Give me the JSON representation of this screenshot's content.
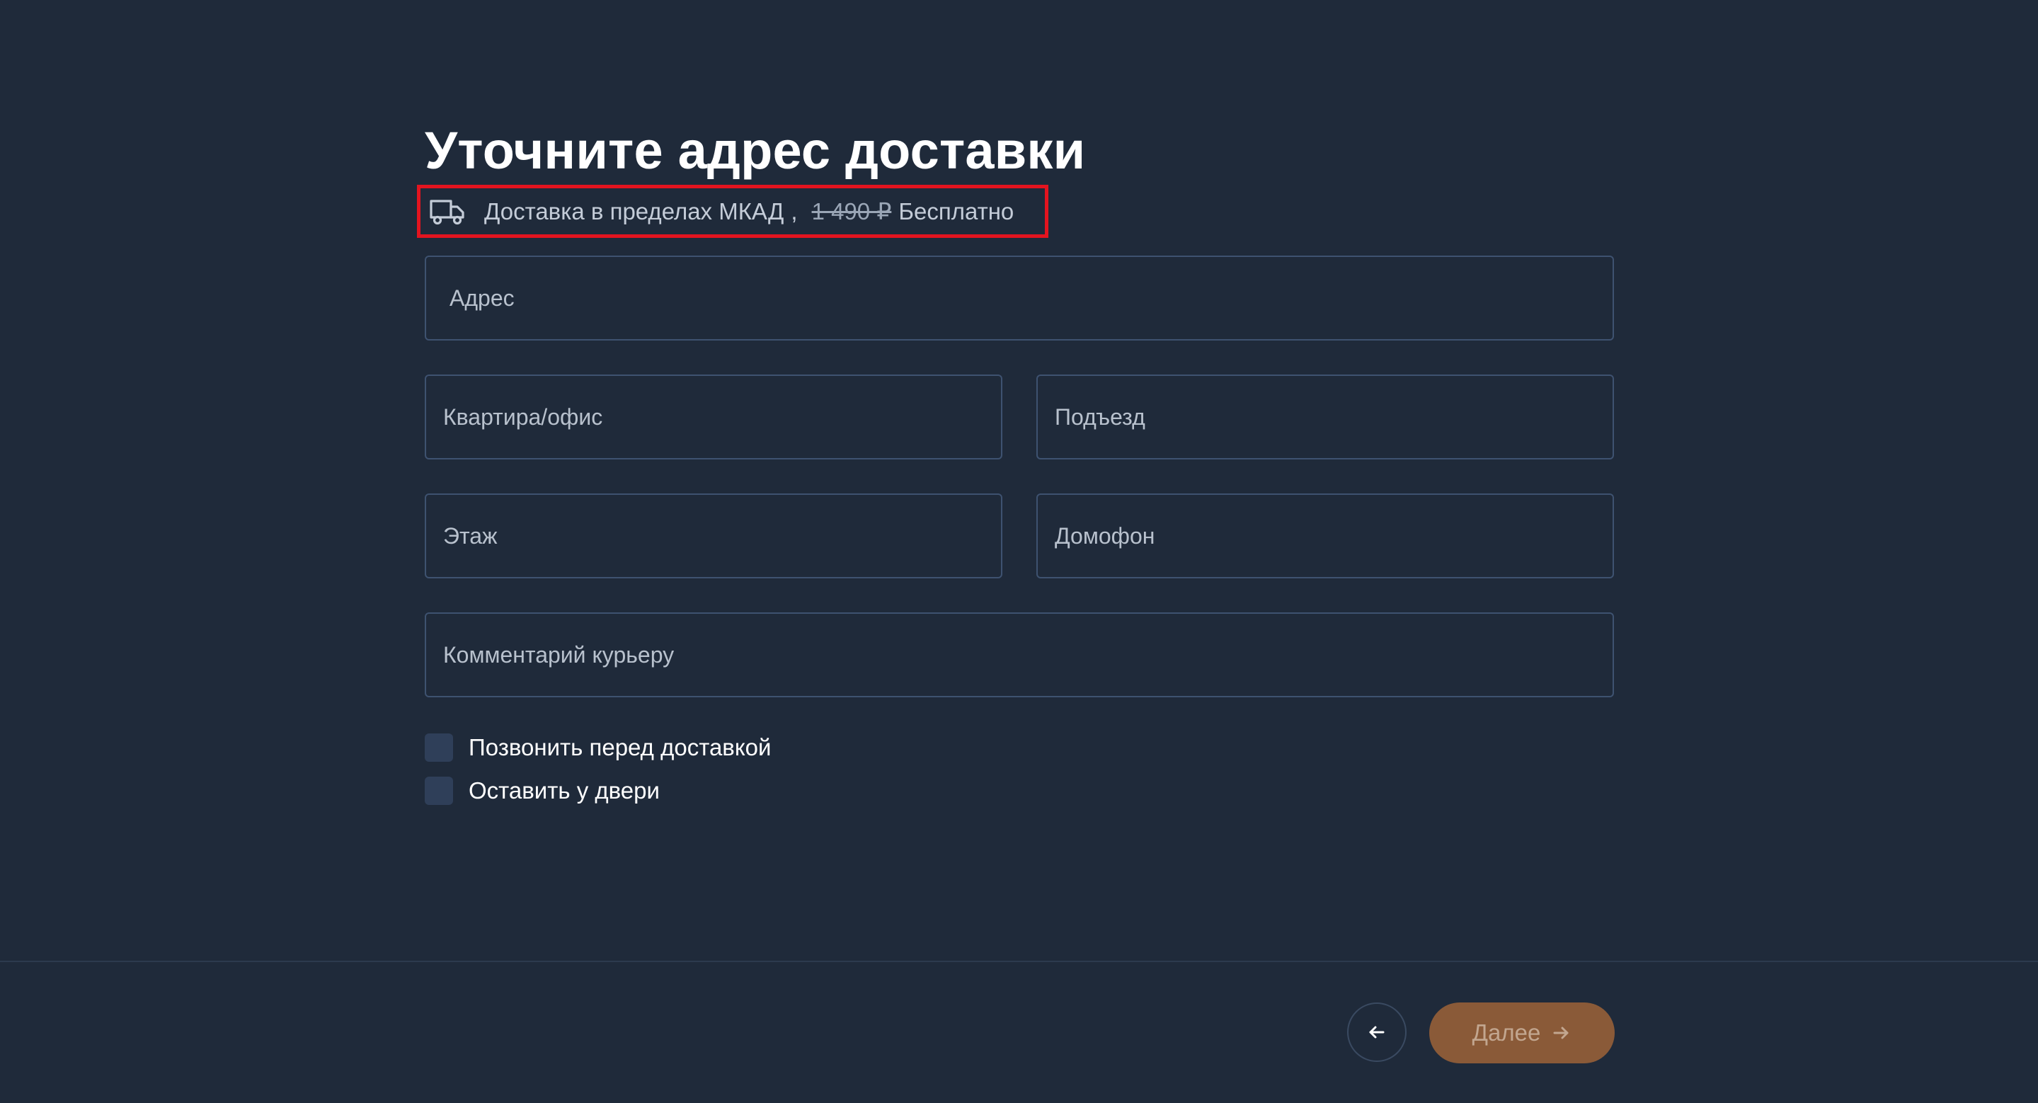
{
  "page": {
    "title": "Уточните адрес доставки"
  },
  "delivery": {
    "icon": "truck-icon",
    "label": "Доставка в пределах МКАД",
    "separator": ",",
    "old_price": "1 490 ₽",
    "new_price": "Бесплатно"
  },
  "form": {
    "address_placeholder": "Адрес",
    "apartment_placeholder": "Квартира/офис",
    "entrance_placeholder": "Подъезд",
    "floor_placeholder": "Этаж",
    "intercom_placeholder": "Домофон",
    "comment_placeholder": "Комментарий курьеру"
  },
  "options": {
    "call_before": {
      "label": "Позвонить перед доставкой",
      "checked": false
    },
    "leave_at_door": {
      "label": "Оставить у двери",
      "checked": false
    }
  },
  "footer": {
    "back_icon": "arrow-left-icon",
    "next_label": "Далее",
    "next_icon": "arrow-right-icon"
  },
  "colors": {
    "background": "#1f2a3a",
    "field_border": "#3e5270",
    "highlight_border": "#e3141f",
    "accent": "#8a5a38"
  }
}
